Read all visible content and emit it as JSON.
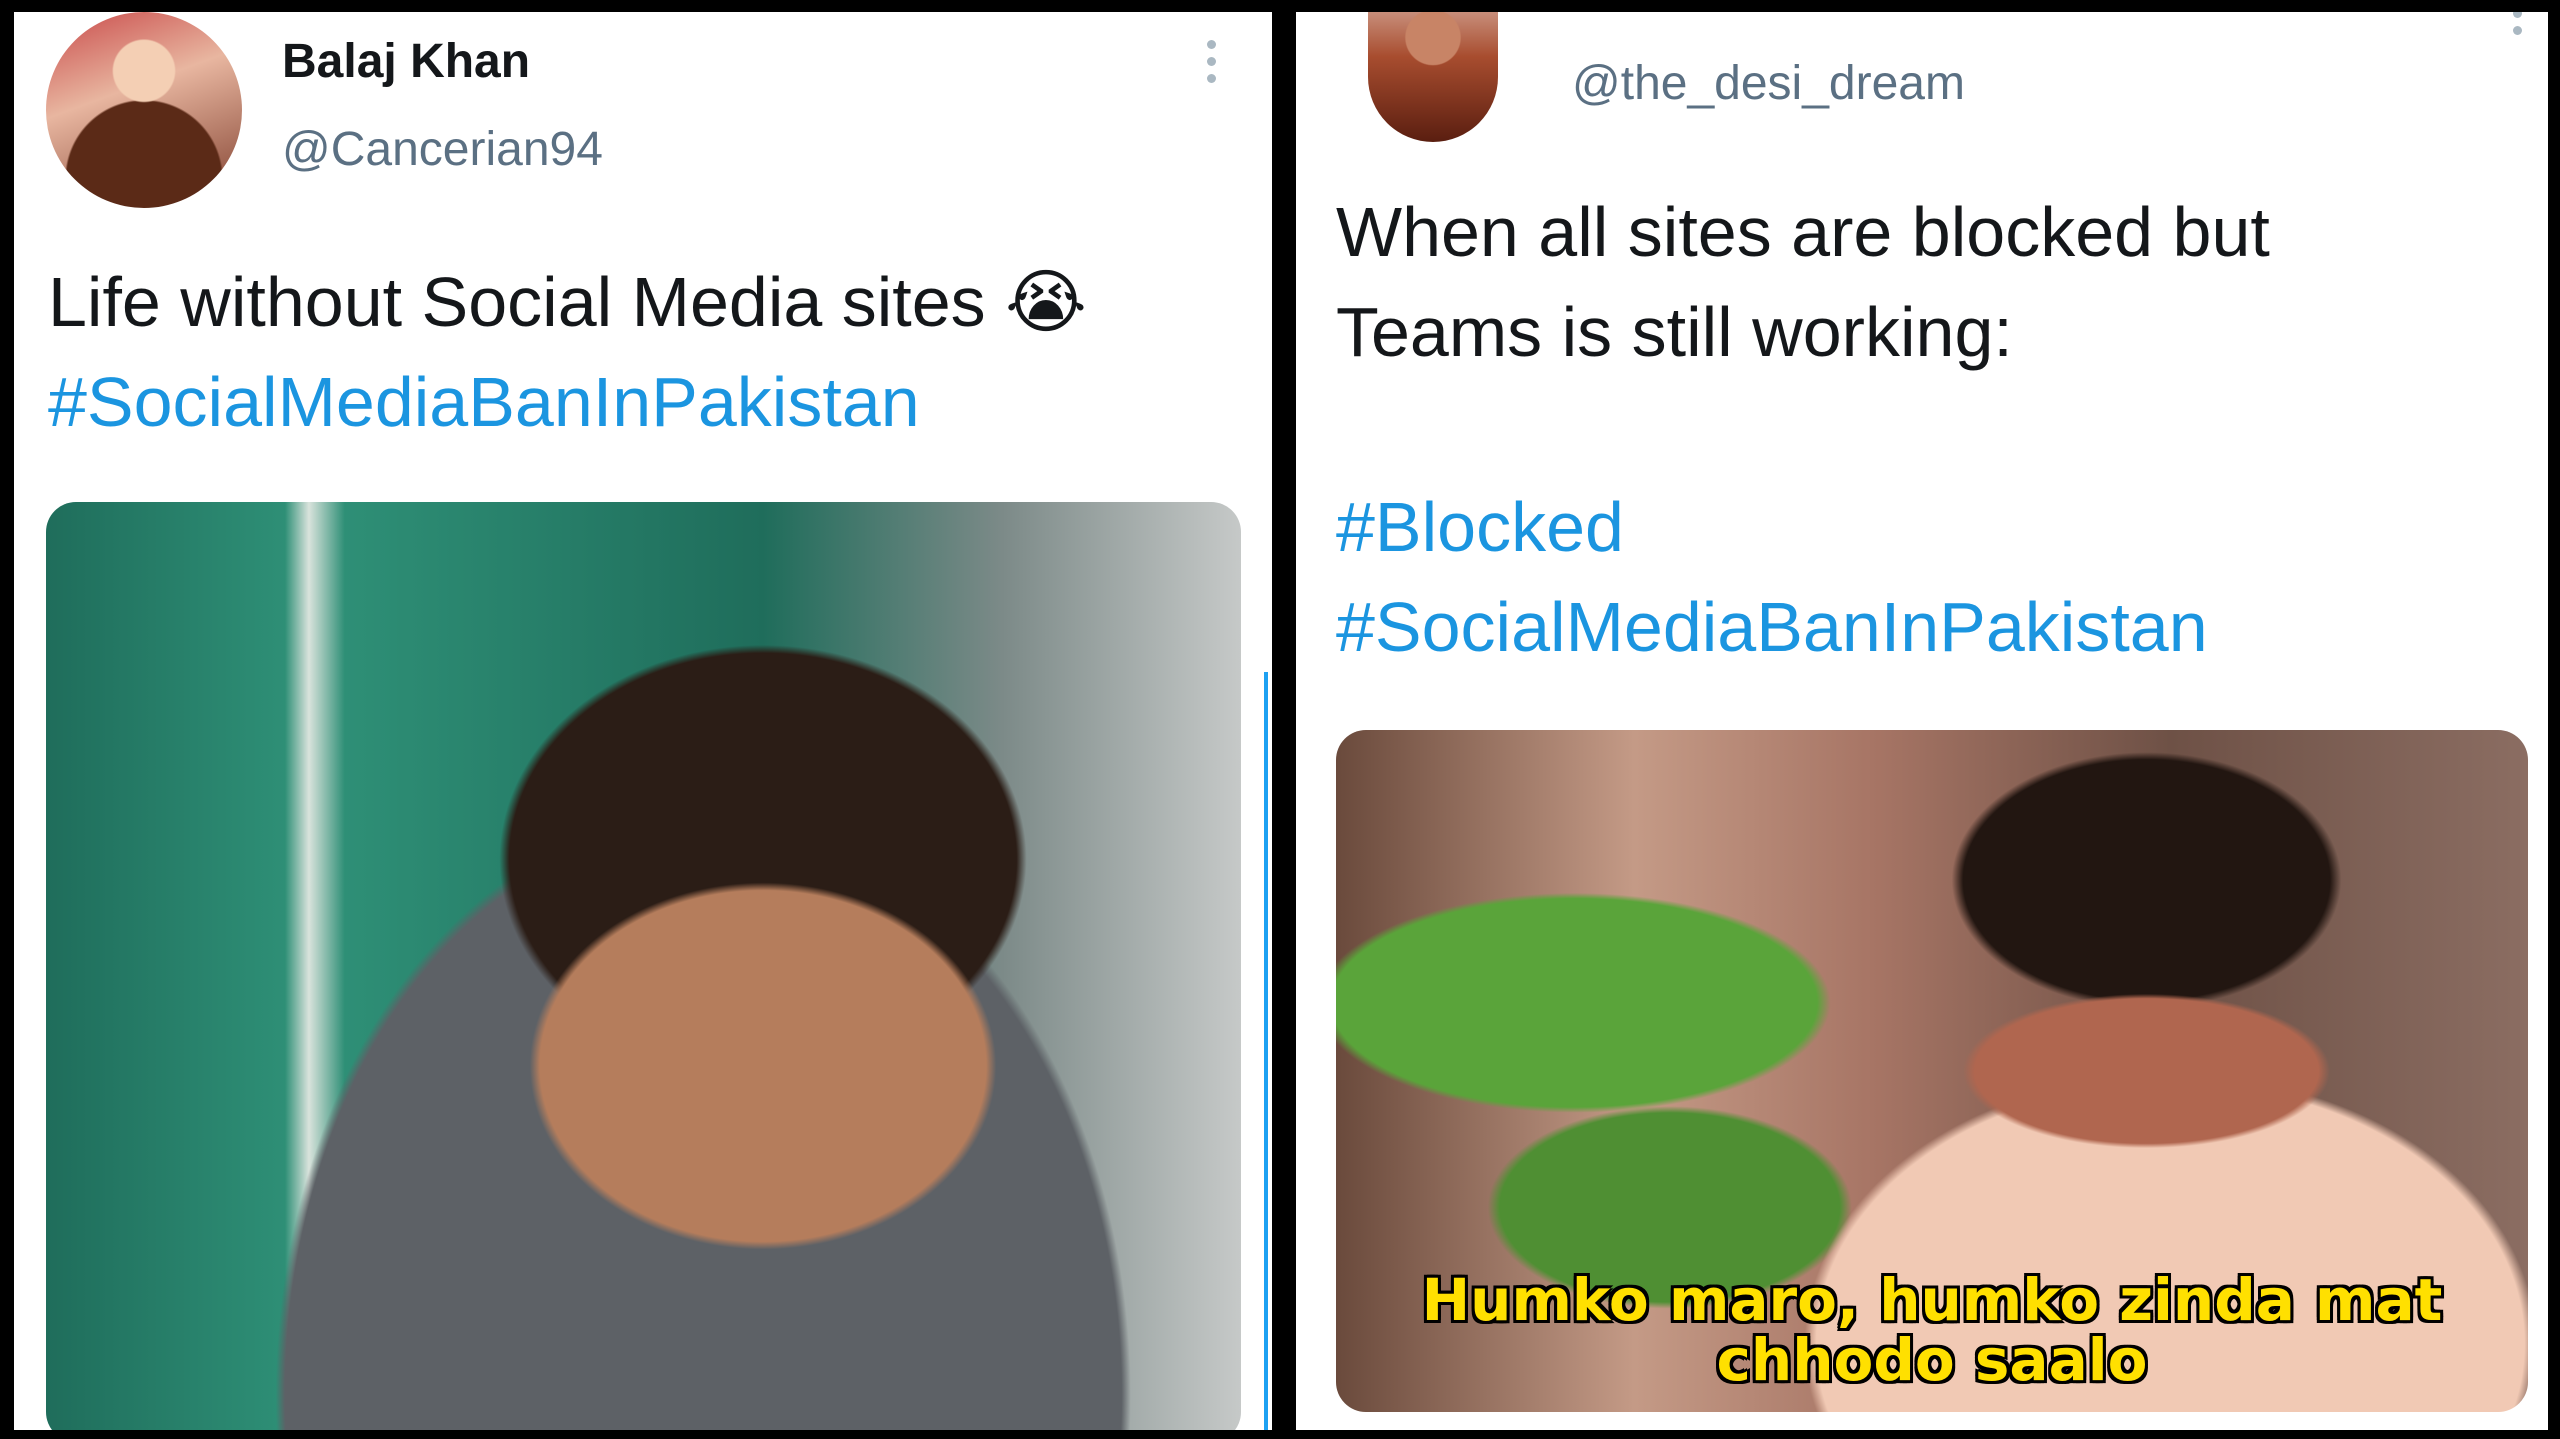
{
  "left_tweet": {
    "author_name": "Balaj Khan",
    "author_handle": "@Cancerian94",
    "text": "Life without Social Media sites",
    "emoji": "😭",
    "hashtag": "#SocialMediaBanInPakistan",
    "more_icon": "more-vertical-icon"
  },
  "right_tweet": {
    "author_handle": "@the_desi_dream",
    "text_line1": "When all sites are blocked but",
    "text_line2": "Teams is still working:",
    "hashtag1": "#Blocked",
    "hashtag2": "#SocialMediaBanInPakistan",
    "media_caption_line1": "Humko maro, humko zinda mat",
    "media_caption_line2": "chhodo saalo",
    "more_icon": "more-vertical-icon"
  },
  "colors": {
    "hashtag": "#1b95e0",
    "handle": "#5b7083",
    "caption": "#ffe000"
  }
}
